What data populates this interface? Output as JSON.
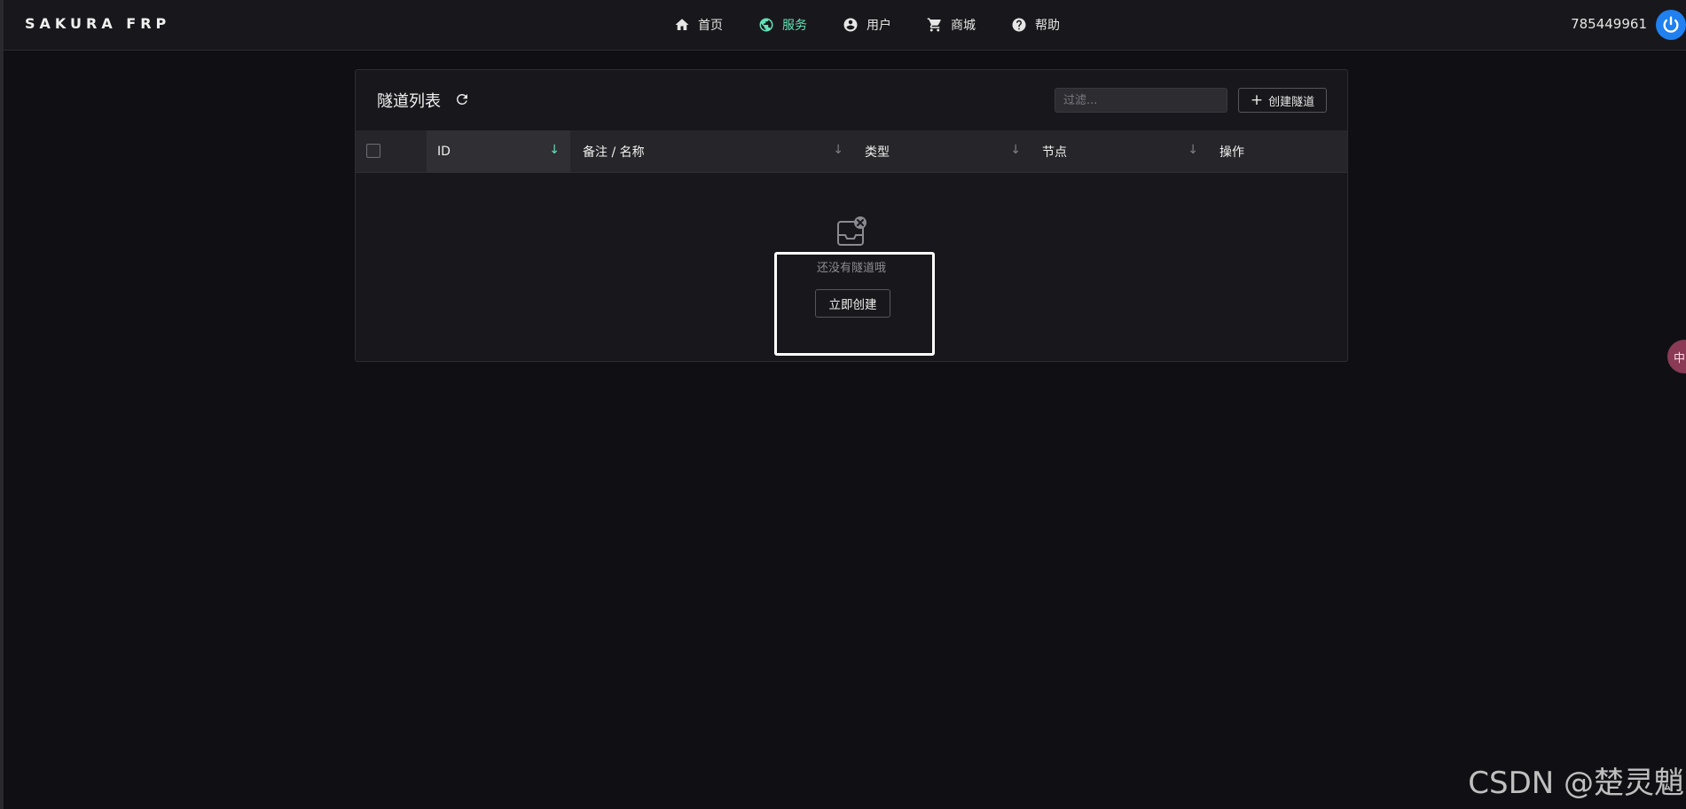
{
  "header": {
    "brand": "SAKURA FRP",
    "nav": [
      {
        "label": "首页",
        "icon": "home-icon",
        "active": false
      },
      {
        "label": "服务",
        "icon": "globe-icon",
        "active": true
      },
      {
        "label": "用户",
        "icon": "user-circle-icon",
        "active": false
      },
      {
        "label": "商城",
        "icon": "cart-icon",
        "active": false
      },
      {
        "label": "帮助",
        "icon": "help-circle-icon",
        "active": false
      }
    ],
    "user_id": "785449961",
    "power_icon": "power-icon"
  },
  "card": {
    "title": "隧道列表",
    "filter_placeholder": "过滤...",
    "create_button_label": "创建隧道",
    "table": {
      "columns": [
        {
          "label": "ID",
          "sorted": true
        },
        {
          "label": "备注 / 名称",
          "sorted": false
        },
        {
          "label": "类型",
          "sorted": false
        },
        {
          "label": "节点",
          "sorted": false
        },
        {
          "label": "操作",
          "sorted": false
        }
      ],
      "sort_glyph": "↓"
    },
    "empty": {
      "message": "还没有隧道哦",
      "action_label": "立即创建"
    }
  },
  "side_float_label": "中",
  "watermark": "CSDN @楚灵魈",
  "colors": {
    "background": "#101014",
    "surface": "#18181c",
    "accent": "#63e2b7",
    "power": "#2080f0",
    "highlight": "#ffffff"
  }
}
